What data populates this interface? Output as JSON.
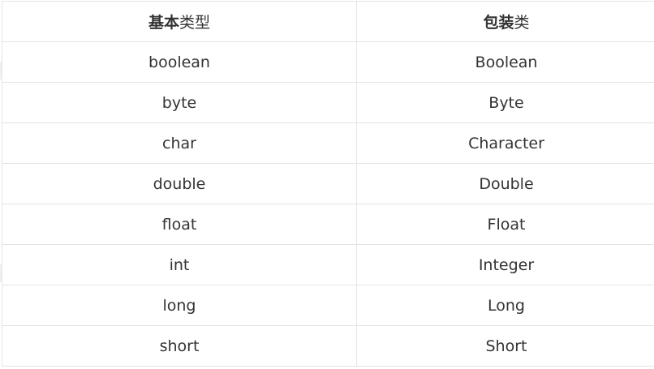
{
  "table": {
    "headers": [
      {
        "bold": "基本",
        "normal": "类型"
      },
      {
        "bold": "包装",
        "normal": "类"
      }
    ],
    "rows": [
      {
        "primitive": "boolean",
        "wrapper": "Boolean"
      },
      {
        "primitive": "byte",
        "wrapper": "Byte"
      },
      {
        "primitive": "char",
        "wrapper": "Character"
      },
      {
        "primitive": "double",
        "wrapper": "Double"
      },
      {
        "primitive": "float",
        "wrapper": "Float"
      },
      {
        "primitive": "int",
        "wrapper": "Integer"
      },
      {
        "primitive": "long",
        "wrapper": "Long"
      },
      {
        "primitive": "short",
        "wrapper": "Short"
      }
    ]
  }
}
